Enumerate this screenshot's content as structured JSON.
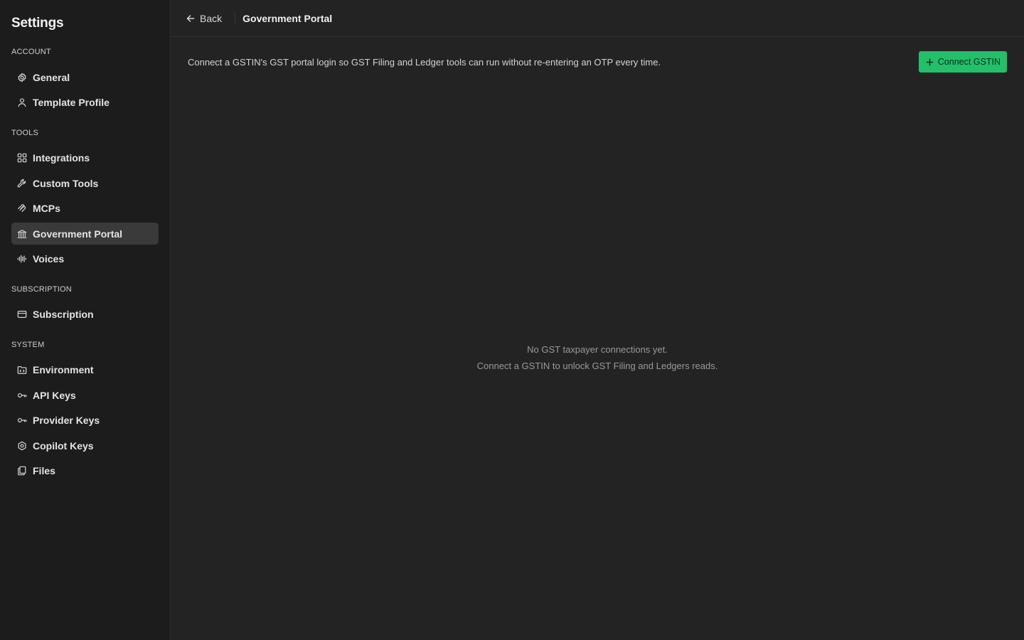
{
  "sidebar": {
    "title": "Settings",
    "sections": [
      {
        "label": "ACCOUNT",
        "items": [
          {
            "label": "General",
            "icon": "gear-icon"
          },
          {
            "label": "Template Profile",
            "icon": "user-icon"
          }
        ]
      },
      {
        "label": "TOOLS",
        "items": [
          {
            "label": "Integrations",
            "icon": "grid-icon"
          },
          {
            "label": "Custom Tools",
            "icon": "wrench-icon"
          },
          {
            "label": "MCPs",
            "icon": "mcp-icon"
          },
          {
            "label": "Government Portal",
            "icon": "bank-icon",
            "active": true
          },
          {
            "label": "Voices",
            "icon": "waveform-icon"
          }
        ]
      },
      {
        "label": "SUBSCRIPTION",
        "items": [
          {
            "label": "Subscription",
            "icon": "card-icon"
          }
        ]
      },
      {
        "label": "SYSTEM",
        "items": [
          {
            "label": "Environment",
            "icon": "folder-code-icon"
          },
          {
            "label": "API Keys",
            "icon": "key-icon"
          },
          {
            "label": "Provider Keys",
            "icon": "key-icon"
          },
          {
            "label": "Copilot Keys",
            "icon": "hexagon-icon"
          },
          {
            "label": "Files",
            "icon": "files-icon"
          }
        ]
      }
    ]
  },
  "header": {
    "back_label": "Back",
    "title": "Government Portal"
  },
  "main": {
    "intro": "Connect a GSTIN's GST portal login so GST Filing and Ledger tools can run without re-entering an OTP every time.",
    "connect_button": "Connect GSTIN",
    "empty_line1": "No GST taxpayer connections yet.",
    "empty_line2": "Connect a GSTIN to unlock GST Filing and Ledgers reads."
  },
  "colors": {
    "accent": "#22c06b",
    "sidebar_bg": "#1c1c1c",
    "main_bg": "#232323",
    "active_item_bg": "#3a3a3a"
  }
}
